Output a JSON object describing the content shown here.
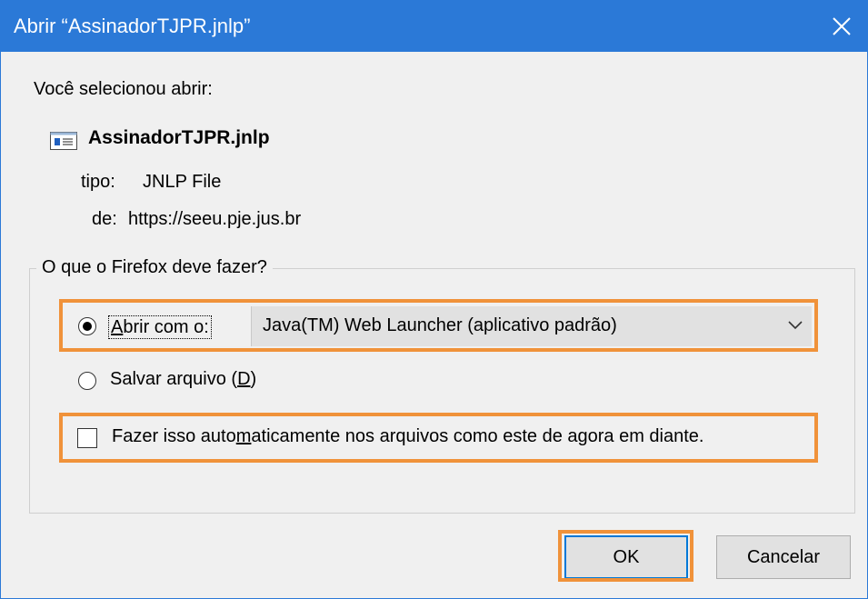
{
  "window": {
    "title": "Abrir “AssinadorTJPR.jnlp”",
    "accent_color": "#2b79d7",
    "highlight_color": "#f0923a",
    "close_icon": "close-icon"
  },
  "intro_text": "Você selecionou abrir:",
  "file": {
    "icon": "document-icon",
    "name": "AssinadorTJPR.jnlp",
    "type_label": "tipo:",
    "type_value": "JNLP File",
    "from_label": "de:",
    "from_value": "https://seeu.pje.jus.br"
  },
  "action_group": {
    "legend": "O que o Firefox deve fazer?",
    "open_with": {
      "label_prefix": "A",
      "label_rest": "brir com o:",
      "selected": true
    },
    "app_select": {
      "value": "Java(TM) Web Launcher (aplicativo padrão)"
    },
    "save_file": {
      "label_prefix": "Salvar arquivo (",
      "label_key": "D",
      "label_suffix": ")",
      "selected": false
    },
    "auto": {
      "label_prefix": "Fazer isso auto",
      "label_key": "m",
      "label_suffix": "aticamente nos arquivos como este de agora em diante.",
      "checked": false
    }
  },
  "buttons": {
    "ok": "OK",
    "cancel": "Cancelar"
  }
}
